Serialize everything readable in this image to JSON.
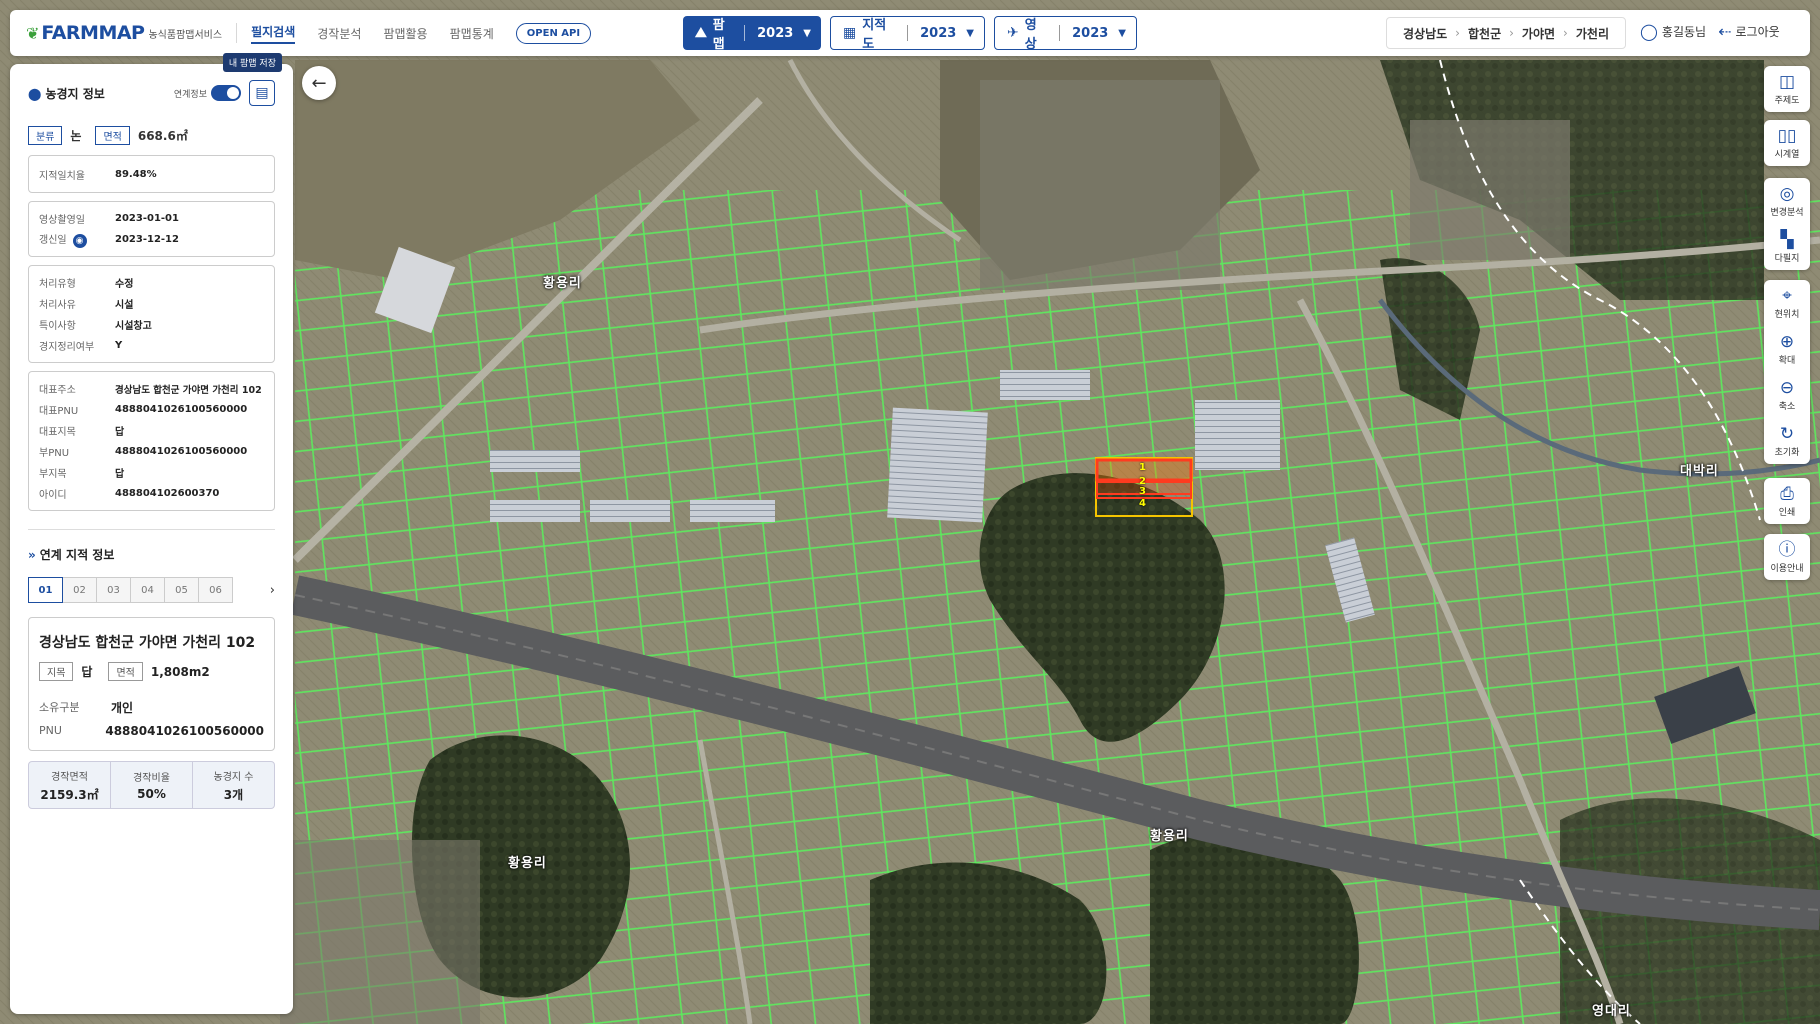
{
  "header": {
    "logo_text": "FARMMAP",
    "logo_sub": "농식품팜맵서비스",
    "nav": [
      "필지검색",
      "경작분석",
      "팜맵활용",
      "팜맵통계"
    ],
    "openapi": "OPEN API",
    "farmmap_label": "팜맵",
    "farmmap_year": "2023",
    "jijuk_label": "지적도",
    "jijuk_year": "2023",
    "image_label": "영상",
    "image_year": "2023",
    "breadcrumb": [
      "경상남도",
      "합천군",
      "가야면",
      "가천리"
    ],
    "user": "홍길동님",
    "logout": "로그아웃"
  },
  "panel": {
    "title": "농경지 정보",
    "toggle_label": "연계정보",
    "save_tooltip": "내 팜맵 저장",
    "class_tag": "분류",
    "class_value": "논",
    "area_tag": "면적",
    "area_value": "668.6㎡",
    "match_label": "지적일치율",
    "match_value": "89.48%",
    "dates": [
      {
        "k": "영상촬영일",
        "v": "2023-01-01"
      },
      {
        "k": "갱신일",
        "v": "2023-12-12"
      }
    ],
    "process": [
      {
        "k": "처리유형",
        "v": "수정"
      },
      {
        "k": "처리사유",
        "v": "시설"
      },
      {
        "k": "특이사항",
        "v": "시설창고"
      },
      {
        "k": "경지정리여부",
        "v": "Y"
      }
    ],
    "address": [
      {
        "k": "대표주소",
        "v": "경상남도 합천군 가야면 가천리 102"
      },
      {
        "k": "대표PNU",
        "v": "4888041026100560000"
      },
      {
        "k": "대표지목",
        "v": "답"
      },
      {
        "k": "부PNU",
        "v": "4888041026100560000"
      },
      {
        "k": "부지목",
        "v": "답"
      },
      {
        "k": "아이디",
        "v": "488804102600370"
      }
    ],
    "linked_title": "연계 지적 정보",
    "tabs": [
      "01",
      "02",
      "03",
      "04",
      "05",
      "06"
    ],
    "card": {
      "title": "경상남도 합천군 가야면 가천리 102",
      "jimok_tag": "지목",
      "jimok_value": "답",
      "area_tag": "면적",
      "area_value": "1,808m2",
      "owner_k": "소유구분",
      "owner_v": "개인",
      "pnu_k": "PNU",
      "pnu_v": "4888041026100560000"
    },
    "stats": [
      {
        "k": "경작면적",
        "v": "2159.3㎡"
      },
      {
        "k": "경작비율",
        "v": "50%"
      },
      {
        "k": "농경지 수",
        "v": "3개"
      }
    ]
  },
  "tools": {
    "group1": [
      {
        "icon": "theme-map-icon",
        "label": "주제도"
      }
    ],
    "group2": [
      {
        "icon": "timeline-icon",
        "label": "시계열"
      }
    ],
    "group3": [
      {
        "icon": "change-analysis-icon",
        "label": "변경분석"
      },
      {
        "icon": "multi-parcel-icon",
        "label": "다필지"
      }
    ],
    "group4": [
      {
        "icon": "location-icon",
        "label": "현위치"
      },
      {
        "icon": "zoom-in-icon",
        "label": "확대"
      },
      {
        "icon": "zoom-out-icon",
        "label": "축소"
      },
      {
        "icon": "reset-icon",
        "label": "초기화"
      }
    ],
    "group5": [
      {
        "icon": "print-icon",
        "label": "인쇄"
      }
    ],
    "group6": [
      {
        "icon": "info-icon",
        "label": "이용안내"
      }
    ]
  },
  "map": {
    "labels": [
      "황용리",
      "황용리",
      "황용리",
      "대박리",
      "영대리"
    ],
    "parcel_numbers": [
      "1",
      "2",
      "3",
      "4"
    ],
    "colors": {
      "parcel": "#5ee85e",
      "selected": "#ff3b1f",
      "linked": "#f5c400",
      "brand": "#1d4ea0"
    }
  }
}
